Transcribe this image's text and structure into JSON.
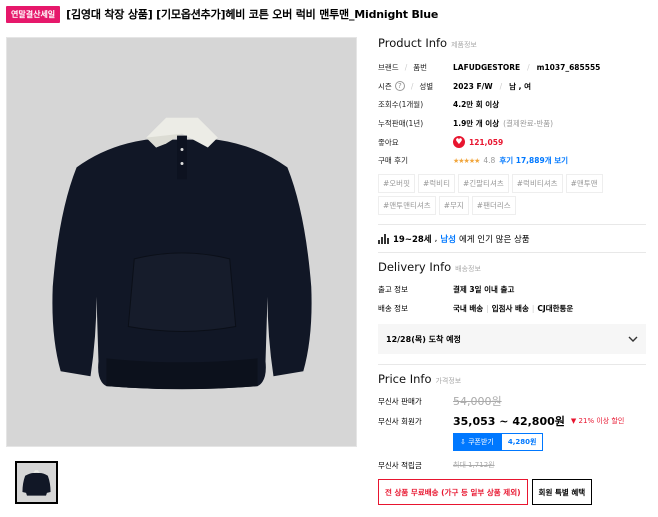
{
  "header": {
    "badge": "연말결산세일",
    "title": "[김영대 착장 상품] [기모옵션추가]헤비 코튼 오버 럭비 맨투맨_Midnight Blue"
  },
  "product_info": {
    "heading": "Product Info",
    "sub": "제품정보",
    "brand_label": "브랜드",
    "code_label": "품번",
    "brand": "LAFUDGESTORE",
    "code": "m1037_685555",
    "season_label": "시즌",
    "gender_label": "성별",
    "season": "2023 F/W",
    "gender": "남 , 여",
    "views_label": "조회수(1개월)",
    "views": "4.2만 회 이상",
    "sales_label": "누적판매(1년)",
    "sales": "1.9만 개 이상",
    "sales_note": "(결제완료-반품)",
    "likes_label": "좋아요",
    "likes": "121,059",
    "review_label": "구매 후기",
    "stars": "★★★★★",
    "rating": "4.8",
    "review_link": "후기 17,889개 보기",
    "tags": [
      "#오버핏",
      "#럭비티",
      "#긴팔티셔츠",
      "#럭비티셔츠",
      "#맨투맨",
      "#맨투맨티셔츠",
      "#무지",
      "#팬더리스"
    ]
  },
  "popular": {
    "age": "19~28세",
    "comma": ",",
    "gender": "남성",
    "text": "에게 인기 많은 상품"
  },
  "delivery": {
    "heading": "Delivery Info",
    "sub": "배송정보",
    "release_label": "출고 정보",
    "release": "결제 3일 이내 출고",
    "ship_label": "배송 정보",
    "ship_1": "국내 배송",
    "ship_2": "입점사 배송",
    "ship_3": "CJ대한통운",
    "arrival": "12/28(목) 도착 예정"
  },
  "price": {
    "heading": "Price Info",
    "sub": "가격정보",
    "musinsa_label": "무신사 판매가",
    "musinsa": "54,000원",
    "member_label": "무신사 회원가",
    "member": "35,053 ~ 42,800원",
    "discount": "21% 이상 할인",
    "coupon_btn": "쿠폰받기",
    "coupon_value": "4,280원",
    "point_label": "무신사 적립금",
    "point": "최대 1,712원",
    "promo_1": "전 상품 무료배송 (가구 등 일부 상품 제외)",
    "promo_2": "회원 특별 혜택"
  },
  "colors": {
    "accent_pink": "#e6186b",
    "accent_blue": "#0078ff",
    "accent_red": "#e8152f",
    "star": "#f1a63d"
  }
}
